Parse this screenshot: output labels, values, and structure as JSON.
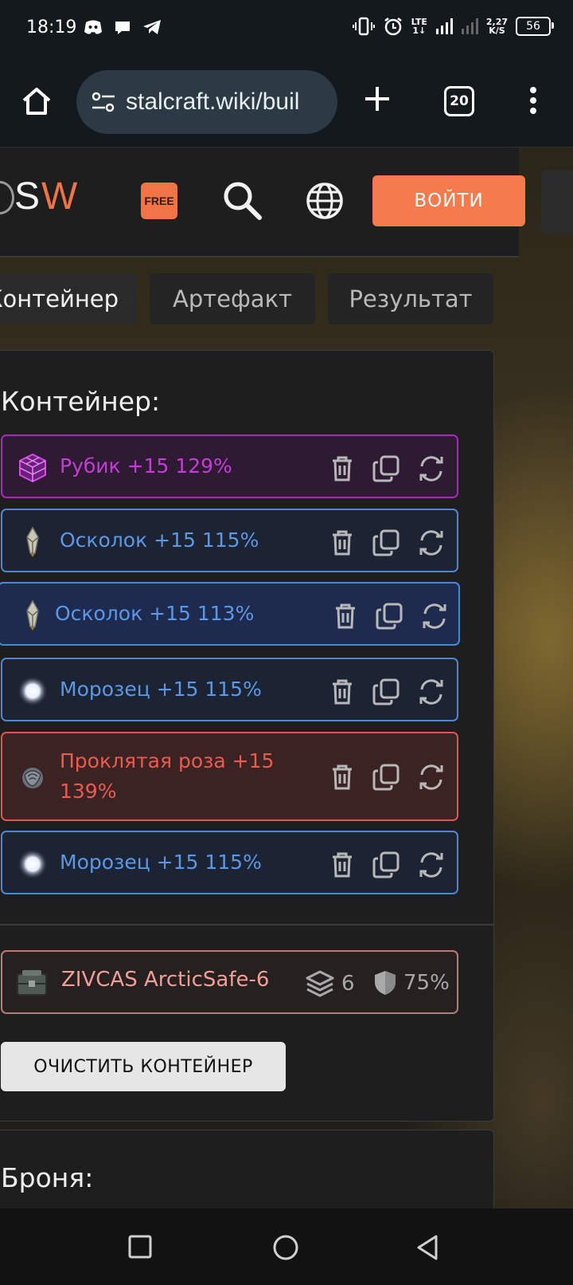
{
  "status_bar": {
    "time": "18:19",
    "net_type_top": "LTE",
    "net_type_bottom": "1↓",
    "speed_value": "2,27",
    "speed_unit": "K/S",
    "battery": "56"
  },
  "browser": {
    "url": "stalcraft.wiki/buil",
    "tab_count": "20"
  },
  "header": {
    "logo_letter_s": "S",
    "logo_letter_w": "W",
    "free_badge": "FREE",
    "login_label": "ВОЙТИ"
  },
  "tabs": [
    {
      "label": "Контейнер"
    },
    {
      "label": "Артефакт"
    },
    {
      "label": "Результат"
    }
  ],
  "container_panel": {
    "title": "Контейнер:",
    "artifacts": [
      {
        "name": "Рубик +15 129%",
        "icon": "rubik-cube-icon",
        "color": "purple"
      },
      {
        "name": "Осколок +15 115%",
        "icon": "shard-crystal-icon",
        "color": "blue"
      },
      {
        "name": "Осколок +15 113%",
        "icon": "shard-crystal-icon",
        "color": "blue"
      },
      {
        "name": "Морозец +15 115%",
        "icon": "frost-orb-icon",
        "color": "blue"
      },
      {
        "name": "Проклятая роза +15 139%",
        "icon": "cursed-rose-icon",
        "color": "red"
      },
      {
        "name": "Морозец +15 115%",
        "icon": "frost-orb-icon",
        "color": "blue"
      }
    ],
    "container_item": {
      "name": "ZIVCAS ArcticSafe-6",
      "slots": "6",
      "protection": "75%"
    },
    "clear_button": "ОЧИСТИТЬ КОНТЕЙНЕР"
  },
  "armor_panel": {
    "title": "Броня:"
  },
  "colors": {
    "accent": "#f57a4d",
    "purple": "#c53dd6",
    "blue": "#5c98e6",
    "red": "#ec5a50"
  }
}
